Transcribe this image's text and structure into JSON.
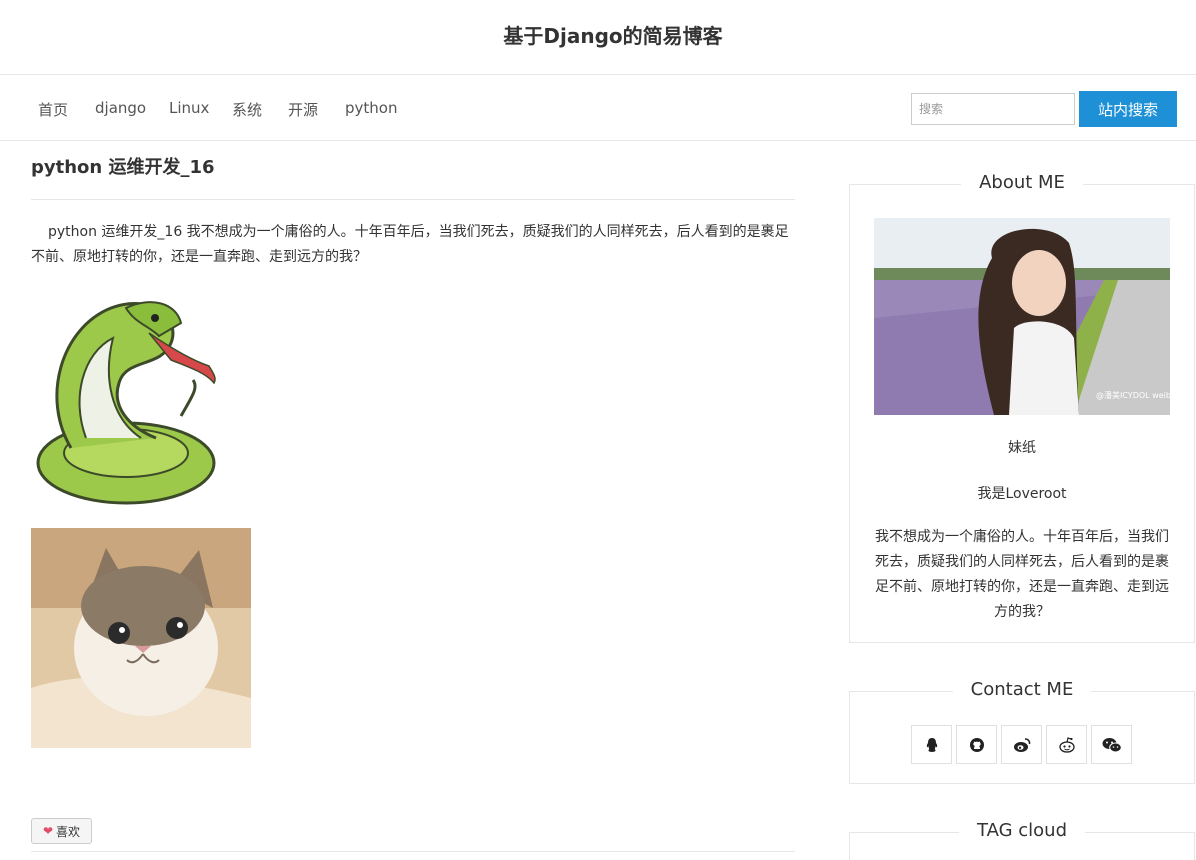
{
  "header": {
    "title": "基于Django的简易博客"
  },
  "nav": {
    "items": [
      {
        "label": "首页"
      },
      {
        "label": "django"
      },
      {
        "label": "Linux"
      },
      {
        "label": "系统"
      },
      {
        "label": "开源"
      },
      {
        "label": "python"
      }
    ],
    "search": {
      "placeholder": "搜索",
      "value": "",
      "button_label": "站内搜索"
    }
  },
  "post": {
    "title": "python 运维开发_16",
    "text": "python 运维开发_16 我不想成为一个庸俗的人。十年百年后，当我们死去，质疑我们的人同样死去，后人看到的是裹足不前、原地打转的你，还是一直奔跑、走到远方的我？",
    "like_label": "喜欢"
  },
  "sidebar": {
    "about": {
      "title": "About ME",
      "photo_watermark": "@潘美ICYDOL weibo.com/felicity",
      "name": "妹纸",
      "line": "我是Loveroot",
      "description": "我不想成为一个庸俗的人。十年百年后，当我们死去，质疑我们的人同样死去，后人看到的是裹足不前、原地打转的你，还是一直奔跑、走到远方的我？"
    },
    "contact": {
      "title": "Contact ME",
      "icons": [
        "qq-icon",
        "github-icon",
        "weibo-icon",
        "reddit-icon",
        "wechat-icon"
      ]
    },
    "tags": {
      "title": "TAG cloud"
    }
  },
  "colors": {
    "accent": "#1e91d6",
    "heart": "#e0506a",
    "border": "#e6e6e6"
  }
}
